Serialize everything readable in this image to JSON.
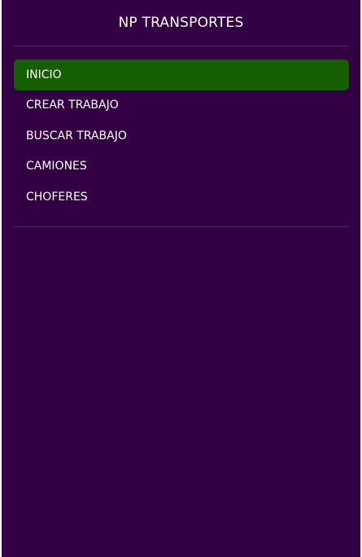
{
  "sidebar": {
    "brand": "NP TRANSPORTES",
    "active_color": "#155f00",
    "background_color": "#330044",
    "items": [
      {
        "label": "INICIO",
        "active": true
      },
      {
        "label": "CREAR TRABAJO",
        "active": false
      },
      {
        "label": "BUSCAR TRABAJO",
        "active": false
      },
      {
        "label": "CAMIONES",
        "active": false
      },
      {
        "label": "CHOFERES",
        "active": false
      }
    ]
  }
}
